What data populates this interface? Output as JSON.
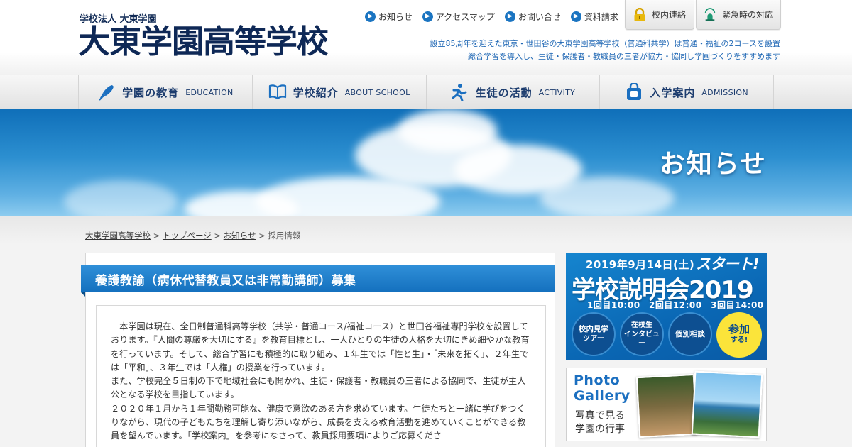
{
  "header": {
    "logo_sub": "学校法人 大東学園",
    "logo_main": "大東学園高等学校",
    "links": [
      {
        "label": "お知らせ"
      },
      {
        "label": "アクセスマップ"
      },
      {
        "label": "お問い合せ"
      },
      {
        "label": "資料請求"
      }
    ],
    "buttons": [
      {
        "label": "校内連絡",
        "icon": "lock-icon"
      },
      {
        "label": "緊急時の対応",
        "icon": "alarm-icon"
      }
    ],
    "tagline": [
      "設立85周年を迎えた東京・世田谷の大東学園高等学校（普通科共学）は普通・福祉の2コースを設置",
      "総合学習を導入し、生徒・保護者・教職員の三者が協力・協同し学園づくりをすすめます"
    ]
  },
  "nav": [
    {
      "jp": "学園の教育",
      "en": "EDUCATION",
      "icon": "pen-icon"
    },
    {
      "jp": "学校紹介",
      "en": "ABOUT SCHOOL",
      "icon": "book-icon"
    },
    {
      "jp": "生徒の活動",
      "en": "ACTIVITY",
      "icon": "running-person-icon"
    },
    {
      "jp": "入学案内",
      "en": "ADMISSION",
      "icon": "bag-icon"
    }
  ],
  "hero": {
    "title": "お知らせ"
  },
  "breadcrumb": {
    "items": [
      "大東学園高等学校",
      "トップページ",
      "お知らせ"
    ],
    "current": "採用情報",
    "sep": " > "
  },
  "article": {
    "title": "養護教諭（病休代替教員又は非常勤講師）募集",
    "paragraphs": [
      "　本学園は現在、全日制普通科高等学校（共学・普通コース/福祉コース）と世田谷福祉専門学校を設置しております。『人間の尊厳を大切にする』を教育目標とし、一人ひとりの生徒の人格を大切にきめ細やかな教育を行っています。そして、総合学習にも積極的に取り組み、１年生では「性と生」・「未来を拓く」、２年生では「平和」、３年生では「人権」の授業を行っています。",
      "また、学校完全５日制の下で地域社会にも開かれ、生徒・保護者・教職員の三者による協同で、生徒が主人公となる学校を目指しています。",
      "２０２０年１月から１年間勤務可能な、健康で意欲のある方を求めています。生徒たちと一緒に学びをつくりながら、現代の子どもたちを理解し寄り添いながら、成長を支える教育活動を進めていくことができる教員を望んでいます。「学校案内」を参考になさって、教員採用要項によりご応募くださ"
    ]
  },
  "sidebar": {
    "event": {
      "date": "2019年9月14日(土)",
      "start": "スタート!",
      "title": "学校説明会2019",
      "times": "1回目10:00　2回目12:00　3回目14:00",
      "circles": [
        "校内見学\nツアー",
        "在校生\nインタビュー",
        "個別相談"
      ],
      "join": "参加",
      "join_sub": "する!",
      "colors": {
        "bg": "#0a67b4",
        "accent": "#fbe43a"
      }
    },
    "photo": {
      "title_1": "Photo",
      "title_2": "Gallery",
      "sub_1": "写真で見る",
      "sub_2": "学園の行事"
    }
  },
  "colors": {
    "brand": "#0e2856",
    "link_blue": "#1d66b4",
    "title_bar": "#1a78c4"
  }
}
